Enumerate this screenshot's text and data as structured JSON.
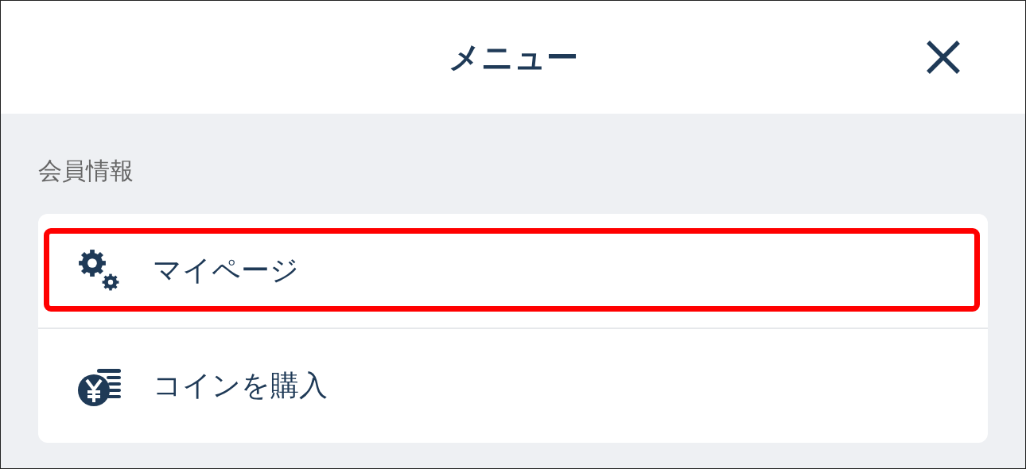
{
  "header": {
    "title": "メニュー"
  },
  "section": {
    "label": "会員情報",
    "items": [
      {
        "label": "マイページ",
        "kind": "gears",
        "highlighted": true
      },
      {
        "label": "コインを購入",
        "kind": "coins",
        "highlighted": false
      }
    ]
  }
}
